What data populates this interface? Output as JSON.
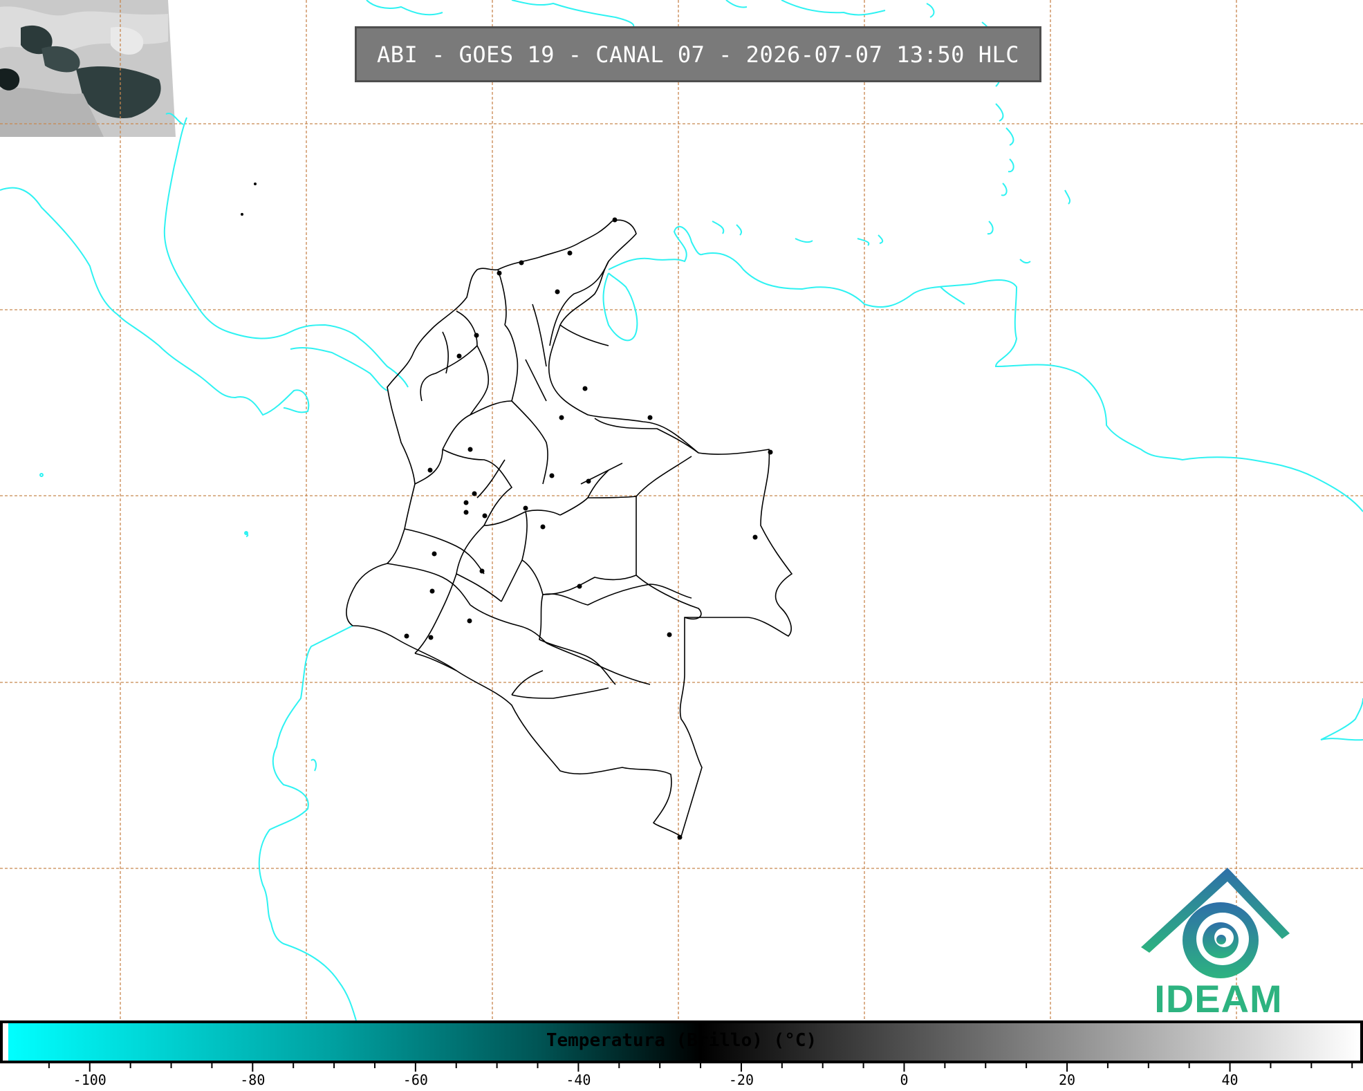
{
  "header": {
    "title": "ABI - GOES 19 - CANAL 07 - 2026-07-07 13:50 HLC"
  },
  "map": {
    "coastline_color": "#2ef2f2",
    "border_color": "#000000",
    "grid_color": "#c8864e",
    "cloud_patch": "satellite-cloud-imagery"
  },
  "logo": {
    "icon": "ideam-mountain-swirl-icon",
    "text": "IDEAM",
    "colors": [
      "#2e6fa8",
      "#2db380"
    ]
  },
  "colorbar": {
    "title": "Temperatura (Brillo) (°C)",
    "min": -110,
    "max": 56,
    "ticks": [
      "-100",
      "-80",
      "-60",
      "-40",
      "-20",
      "0",
      "20",
      "40"
    ],
    "tick_values": [
      -100,
      -80,
      -60,
      -40,
      -20,
      0,
      20,
      40
    ],
    "stops": [
      {
        "value": -110,
        "color": "#00ffff"
      },
      {
        "value": -70,
        "color": "#00a0a0"
      },
      {
        "value": -45,
        "color": "#005555"
      },
      {
        "value": -25,
        "color": "#000000"
      },
      {
        "value": -15,
        "color": "#202020"
      },
      {
        "value": 56,
        "color": "#ffffff"
      }
    ]
  }
}
